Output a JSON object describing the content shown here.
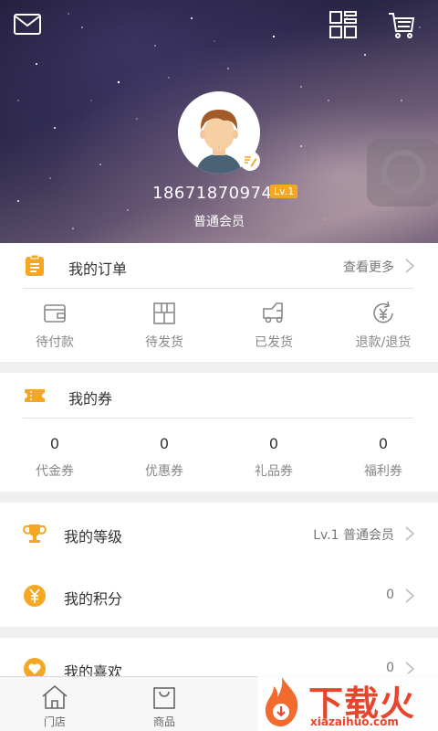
{
  "header": {
    "phone": "18671870974",
    "level_badge": "Lv.1",
    "member_type": "普通会员"
  },
  "orders": {
    "title": "我的订单",
    "more": "查看更多",
    "items": [
      {
        "label": "待付款",
        "icon": "wallet-icon"
      },
      {
        "label": "待发货",
        "icon": "package-icon"
      },
      {
        "label": "已发货",
        "icon": "truck-icon"
      },
      {
        "label": "退款/退货",
        "icon": "refund-icon"
      }
    ]
  },
  "coupons": {
    "title": "我的券",
    "items": [
      {
        "value": "0",
        "label": "代金券"
      },
      {
        "value": "0",
        "label": "优惠券"
      },
      {
        "value": "0",
        "label": "礼品券"
      },
      {
        "value": "0",
        "label": "福利券"
      }
    ]
  },
  "menu": [
    {
      "title": "我的等级",
      "value": "Lv.1 普通会员",
      "icon": "trophy-icon"
    },
    {
      "title": "我的积分",
      "value": "0",
      "icon": "yen-coin-icon"
    },
    {
      "title": "我的喜欢",
      "value": "0",
      "icon": "heart-icon"
    }
  ],
  "tabbar": [
    {
      "label": "门店",
      "icon": "store-icon"
    },
    {
      "label": "商品",
      "icon": "shopping-bag-icon"
    }
  ],
  "watermark": {
    "text": "下载火",
    "url": "xiazaihuo.com"
  },
  "colors": {
    "accent": "#f5a623",
    "watermark_red": "#e8452c"
  }
}
